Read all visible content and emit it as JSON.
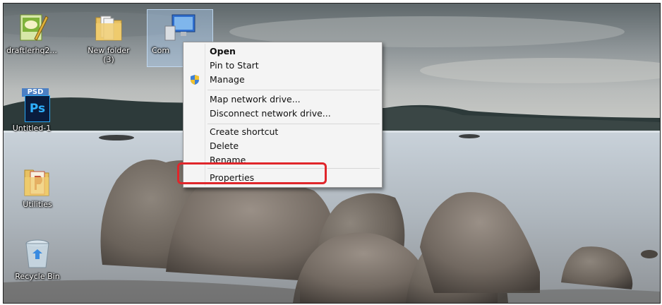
{
  "desktop": {
    "icons": [
      {
        "label": "draftlerhq2...",
        "icon": "notepad-document-icon"
      },
      {
        "label": "New folder (3)",
        "icon": "folder-icon"
      },
      {
        "label": "Com",
        "icon": "computer-icon"
      },
      {
        "label": "Untitled-1",
        "icon": "photoshop-psd-icon",
        "badge": "PSD",
        "app": "Ps"
      },
      {
        "label": "Utilities",
        "icon": "folder-icon"
      },
      {
        "label": "Recycle Bin",
        "icon": "recycle-bin-icon"
      }
    ]
  },
  "context_menu": {
    "items": [
      {
        "label": "Open",
        "bold": true
      },
      {
        "label": "Pin to Start"
      },
      {
        "label": "Manage",
        "icon": "uac-shield-icon"
      },
      {
        "label": "Map network drive..."
      },
      {
        "label": "Disconnect network drive..."
      },
      {
        "label": "Create shortcut"
      },
      {
        "label": "Delete"
      },
      {
        "label": "Rename"
      },
      {
        "label": "Properties",
        "highlighted": true
      }
    ]
  },
  "colors": {
    "highlight_outline": "#e0262b",
    "menu_background": "#f4f4f4"
  }
}
